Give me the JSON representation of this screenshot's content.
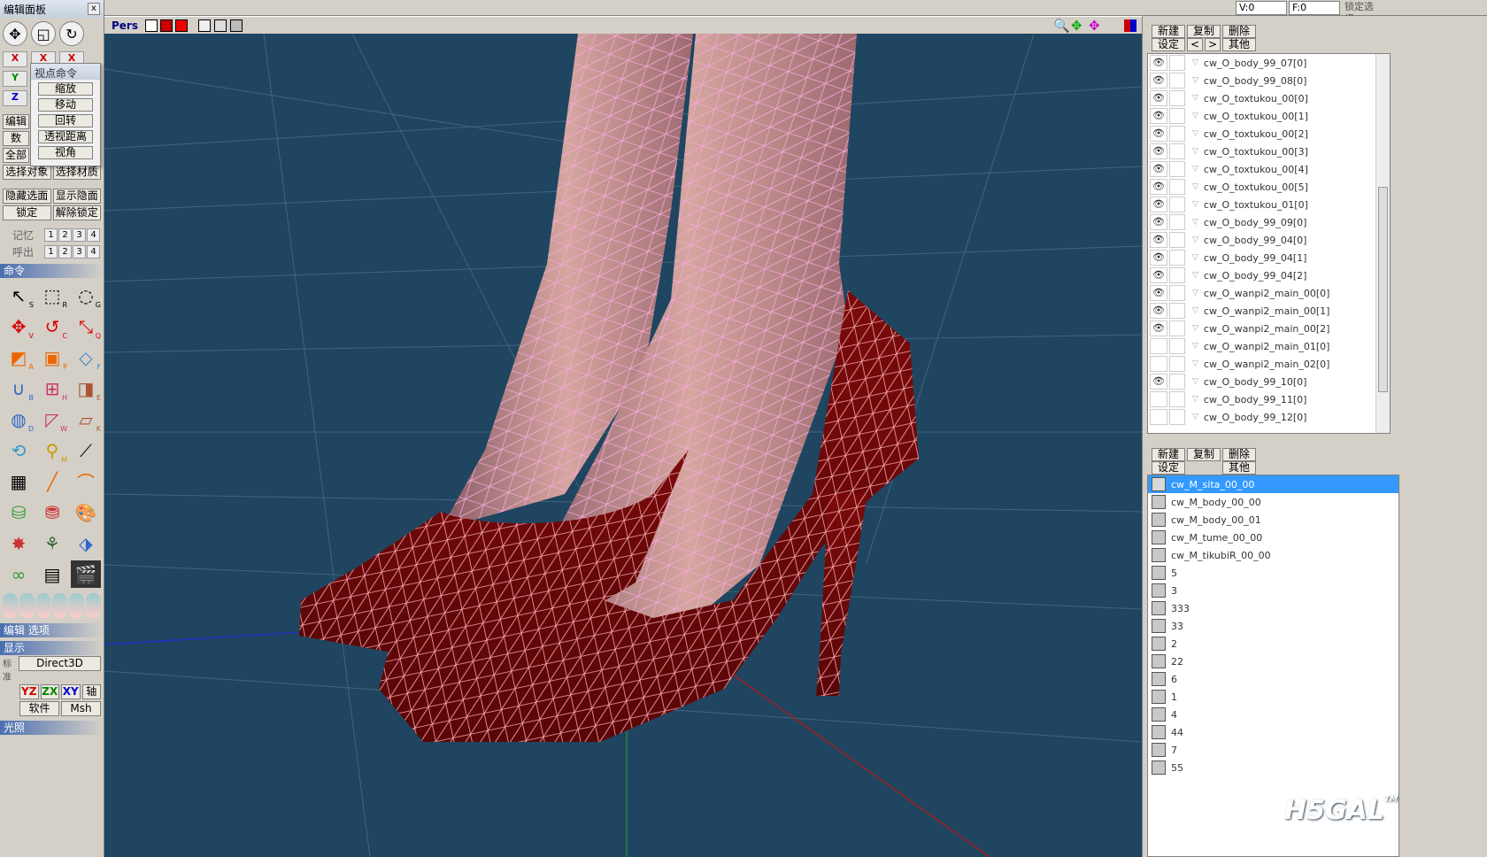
{
  "top": {
    "v_label": "V:0",
    "f_label": "F:0",
    "lock_select": "锁定选择"
  },
  "left_panel": {
    "title": "编辑面板",
    "close": "x",
    "axis": [
      "X",
      "Y",
      "Z"
    ],
    "partial": [
      "编辑",
      "数",
      "全部",
      "选择对象",
      "选择材质"
    ],
    "hide_show": [
      "隐藏选面",
      "显示隐面"
    ],
    "lock_unlock": [
      "锁定",
      "解除锁定"
    ],
    "memory": {
      "label": "记忆",
      "nums": [
        "1",
        "2",
        "3",
        "4"
      ]
    },
    "recall": {
      "label": "呼出",
      "nums": [
        "1",
        "2",
        "3",
        "4"
      ]
    },
    "command_section": "命令",
    "edit_options": "编辑 选项",
    "display_section": "显示",
    "render_mode": "Direct3D",
    "planes": [
      "YZ",
      "ZX",
      "XY",
      "轴"
    ],
    "planes_label": "标准",
    "software": "软件",
    "msh": "Msh",
    "light_section": "光照"
  },
  "popup": {
    "title": "视点命令",
    "items": [
      "缩放",
      "移动",
      "回转",
      "透视距离",
      "视角"
    ]
  },
  "viewport": {
    "mode": "Pers"
  },
  "objects": {
    "buttons": [
      "新建",
      "复制",
      "删除",
      "设定",
      "<",
      ">",
      "其他"
    ],
    "items": [
      {
        "name": "cw_O_body_99_07[0]",
        "visible": true
      },
      {
        "name": "cw_O_body_99_08[0]",
        "visible": true
      },
      {
        "name": "cw_O_toxtukou_00[0]",
        "visible": true
      },
      {
        "name": "cw_O_toxtukou_00[1]",
        "visible": true
      },
      {
        "name": "cw_O_toxtukou_00[2]",
        "visible": true
      },
      {
        "name": "cw_O_toxtukou_00[3]",
        "visible": true
      },
      {
        "name": "cw_O_toxtukou_00[4]",
        "visible": true
      },
      {
        "name": "cw_O_toxtukou_00[5]",
        "visible": true
      },
      {
        "name": "cw_O_toxtukou_01[0]",
        "visible": true
      },
      {
        "name": "cw_O_body_99_09[0]",
        "visible": true
      },
      {
        "name": "cw_O_body_99_04[0]",
        "visible": true
      },
      {
        "name": "cw_O_body_99_04[1]",
        "visible": true
      },
      {
        "name": "cw_O_body_99_04[2]",
        "visible": true
      },
      {
        "name": "cw_O_wanpi2_main_00[0]",
        "visible": true
      },
      {
        "name": "cw_O_wanpi2_main_00[1]",
        "visible": true
      },
      {
        "name": "cw_O_wanpi2_main_00[2]",
        "visible": true
      },
      {
        "name": "cw_O_wanpi2_main_01[0]",
        "visible": false
      },
      {
        "name": "cw_O_wanpi2_main_02[0]",
        "visible": false
      },
      {
        "name": "cw_O_body_99_10[0]",
        "visible": true
      },
      {
        "name": "cw_O_body_99_11[0]",
        "visible": false
      },
      {
        "name": "cw_O_body_99_12[0]",
        "visible": false
      }
    ]
  },
  "materials": {
    "buttons": [
      "新建",
      "复制",
      "删除",
      "设定",
      "其他"
    ],
    "items": [
      "cw_M_sita_00_00",
      "cw_M_body_00_00",
      "cw_M_body_00_01",
      "cw_M_tume_00_00",
      "cw_M_tikubiR_00_00",
      "5",
      "3",
      "333",
      "33",
      "2",
      "22",
      "6",
      "1",
      "4",
      "44",
      "7",
      "55"
    ],
    "selected_index": 0
  },
  "watermark": "H5GAL",
  "watermark_tm": "TM"
}
